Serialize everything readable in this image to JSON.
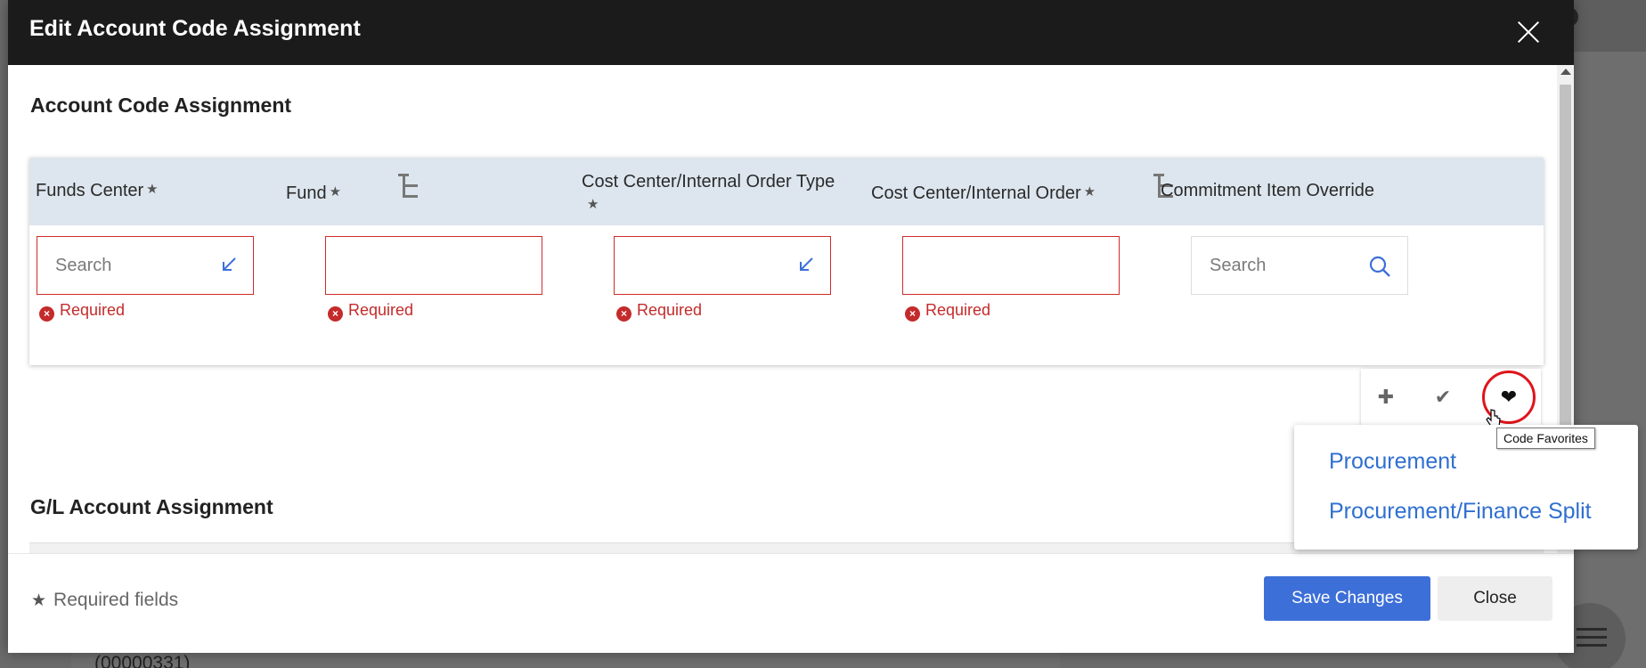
{
  "background": {
    "bottom_text": "(00000331)"
  },
  "modal": {
    "title": "Edit Account Code Assignment"
  },
  "account_section": {
    "title": "Account Code Assignment",
    "columns": [
      {
        "label": "Funds Center",
        "required": true,
        "placeholder": "Search",
        "error": "Required"
      },
      {
        "label": "Fund",
        "required": true,
        "placeholder": "",
        "error": "Required"
      },
      {
        "label": "Cost Center/Internal Order Type",
        "required": true,
        "placeholder": "",
        "error": "Required"
      },
      {
        "label": "Cost Center/Internal Order",
        "required": true,
        "placeholder": "",
        "error": "Required"
      },
      {
        "label": "Commitment Item Override",
        "required": false,
        "placeholder": "Search",
        "error": ""
      }
    ]
  },
  "actions": {
    "add_icon": "plus-icon",
    "apply_icon": "check-icon",
    "favorites_icon": "heart-icon",
    "tooltip": "Code Favorites"
  },
  "favorites_menu": {
    "items": [
      "Procurement",
      "Procurement/Finance Split"
    ]
  },
  "gl_section": {
    "title": "G/L Account Assignment"
  },
  "footer": {
    "required_note": "Required fields",
    "save_label": "Save Changes",
    "close_label": "Close"
  },
  "colors": {
    "header_bg": "#1b1b1b",
    "primary": "#3d6fd8",
    "error": "#c42b2b",
    "link": "#2f6fd0",
    "highlight_ring": "#e0141b"
  }
}
